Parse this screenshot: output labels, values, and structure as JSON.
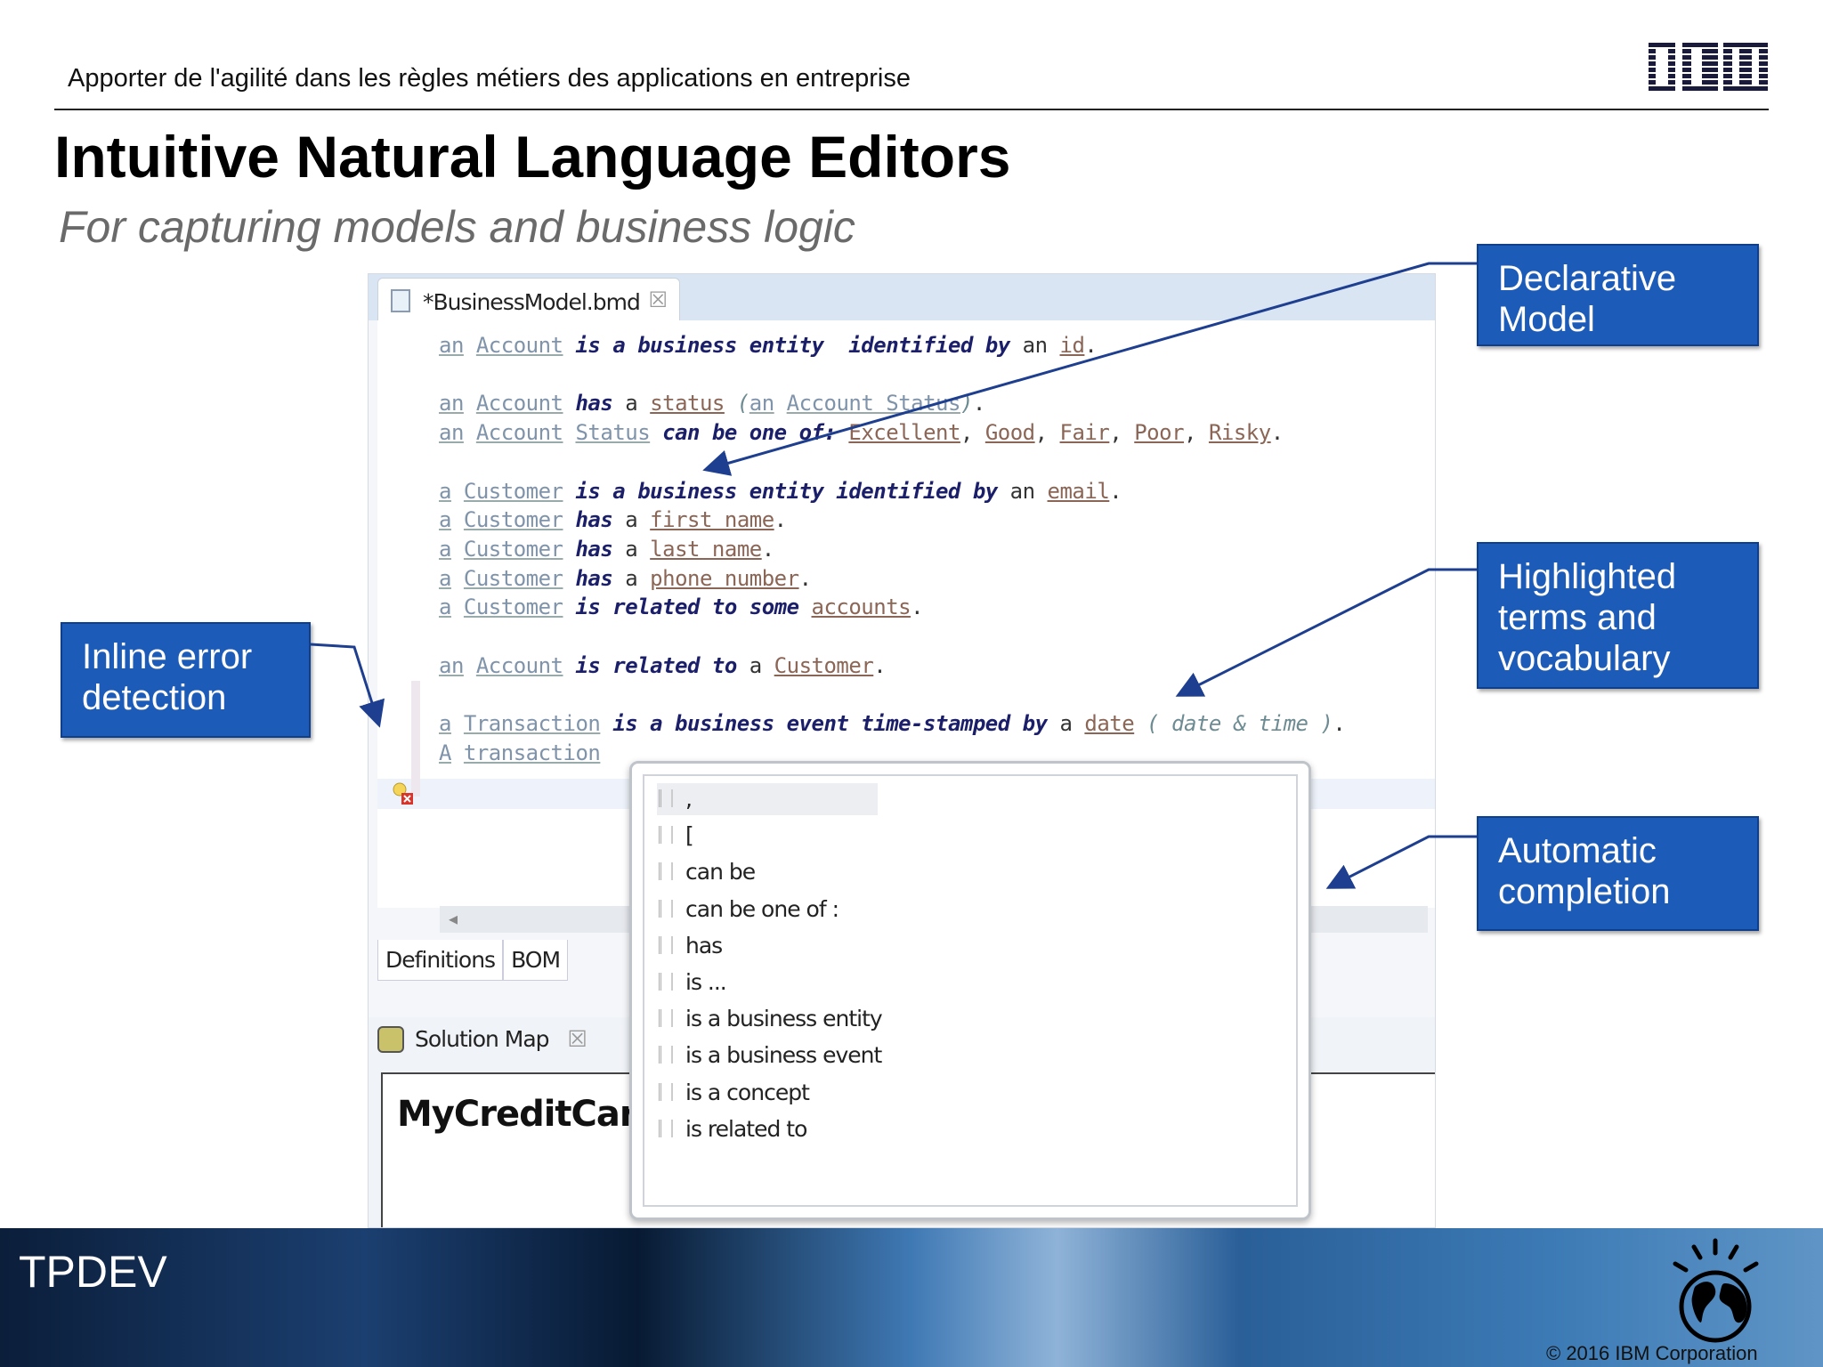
{
  "header": {
    "subject": "Apporter de l'agilité dans les règles métiers des applications en entreprise",
    "logo": "IBM"
  },
  "title": "Intuitive Natural Language Editors",
  "subtitle": "For capturing models and business logic",
  "editor": {
    "tab_label": "*BusinessModel.bmd",
    "lines": [
      [
        [
          "tm",
          "an"
        ],
        [
          "pl",
          " "
        ],
        [
          "tm",
          "Account"
        ],
        [
          "pl",
          " "
        ],
        [
          "kw",
          "is a business entity  identified by"
        ],
        [
          "pl",
          " an "
        ],
        [
          "at",
          "id"
        ],
        [
          "pl",
          "."
        ]
      ],
      [],
      [
        [
          "tm",
          "an"
        ],
        [
          "pl",
          " "
        ],
        [
          "tm",
          "Account"
        ],
        [
          "pl",
          " "
        ],
        [
          "kw",
          "has"
        ],
        [
          "pl",
          " a "
        ],
        [
          "at",
          "status"
        ],
        [
          "pl",
          " "
        ],
        [
          "it",
          "("
        ],
        [
          "tm",
          "an"
        ],
        [
          "pl",
          " "
        ],
        [
          "tm",
          "Account Status"
        ],
        [
          "it",
          ")"
        ],
        [
          "pl",
          "."
        ]
      ],
      [
        [
          "tm",
          "an"
        ],
        [
          "pl",
          " "
        ],
        [
          "tm",
          "Account"
        ],
        [
          "pl",
          " "
        ],
        [
          "tm",
          "Status"
        ],
        [
          "pl",
          " "
        ],
        [
          "kw",
          "can be one of:"
        ],
        [
          "pl",
          " "
        ],
        [
          "at",
          "Excellent"
        ],
        [
          "pl",
          ", "
        ],
        [
          "at",
          "Good"
        ],
        [
          "pl",
          ", "
        ],
        [
          "at",
          "Fair"
        ],
        [
          "pl",
          ", "
        ],
        [
          "at",
          "Poor"
        ],
        [
          "pl",
          ", "
        ],
        [
          "at",
          "Risky"
        ],
        [
          "pl",
          "."
        ]
      ],
      [],
      [
        [
          "tm",
          "a"
        ],
        [
          "pl",
          " "
        ],
        [
          "tm",
          "Customer"
        ],
        [
          "pl",
          " "
        ],
        [
          "kw",
          "is a business entity identified by"
        ],
        [
          "pl",
          " an "
        ],
        [
          "at",
          "email"
        ],
        [
          "pl",
          "."
        ]
      ],
      [
        [
          "tm",
          "a"
        ],
        [
          "pl",
          " "
        ],
        [
          "tm",
          "Customer"
        ],
        [
          "pl",
          " "
        ],
        [
          "kw",
          "has"
        ],
        [
          "pl",
          " a "
        ],
        [
          "at",
          "first name"
        ],
        [
          "pl",
          "."
        ]
      ],
      [
        [
          "tm",
          "a"
        ],
        [
          "pl",
          " "
        ],
        [
          "tm",
          "Customer"
        ],
        [
          "pl",
          " "
        ],
        [
          "kw",
          "has"
        ],
        [
          "pl",
          " a "
        ],
        [
          "at",
          "last name"
        ],
        [
          "pl",
          "."
        ]
      ],
      [
        [
          "tm",
          "a"
        ],
        [
          "pl",
          " "
        ],
        [
          "tm",
          "Customer"
        ],
        [
          "pl",
          " "
        ],
        [
          "kw",
          "has"
        ],
        [
          "pl",
          " a "
        ],
        [
          "at",
          "phone number"
        ],
        [
          "pl",
          "."
        ]
      ],
      [
        [
          "tm",
          "a"
        ],
        [
          "pl",
          " "
        ],
        [
          "tm",
          "Customer"
        ],
        [
          "pl",
          " "
        ],
        [
          "kw",
          "is related to some"
        ],
        [
          "pl",
          " "
        ],
        [
          "at",
          "accounts"
        ],
        [
          "pl",
          "."
        ]
      ],
      [],
      [
        [
          "tm",
          "an"
        ],
        [
          "pl",
          " "
        ],
        [
          "tm",
          "Account"
        ],
        [
          "pl",
          " "
        ],
        [
          "kw",
          "is related to"
        ],
        [
          "pl",
          " a "
        ],
        [
          "at",
          "Customer"
        ],
        [
          "pl",
          "."
        ]
      ],
      [],
      [
        [
          "tm",
          "a"
        ],
        [
          "pl",
          " "
        ],
        [
          "tm",
          "Transaction"
        ],
        [
          "pl",
          " "
        ],
        [
          "kw",
          "is a business event time-stamped by"
        ],
        [
          "pl",
          " a "
        ],
        [
          "at",
          "date"
        ],
        [
          "pl",
          " "
        ],
        [
          "it",
          "( date & time )"
        ],
        [
          "pl",
          "."
        ]
      ],
      [
        [
          "tm",
          "A"
        ],
        [
          "pl",
          " "
        ],
        [
          "tm",
          "transaction"
        ]
      ]
    ],
    "bottom_tabs": [
      "Definitions",
      "BOM"
    ]
  },
  "solution_map": {
    "tab_label": "Solution Map",
    "content": "MyCreditCard"
  },
  "completion_items": [
    ",",
    "[",
    "can be",
    "can be one of :",
    "has",
    "is ...",
    "is a business entity",
    "is a business event",
    "is a concept",
    "is related to"
  ],
  "callouts": {
    "declarative": "Declarative Model",
    "highlighted": "Highlighted terms and vocabulary",
    "automatic": "Automatic completion",
    "inline_error": "Inline error detection"
  },
  "footer": {
    "label": "TPDEV",
    "copyright": "© 2016 IBM Corporation"
  },
  "colors": {
    "callout": "#1c5cb8",
    "arrow": "#1e3f8f",
    "keyword": "#1b1f6a",
    "term": "#7f93aa",
    "attribute": "#8b6656"
  }
}
